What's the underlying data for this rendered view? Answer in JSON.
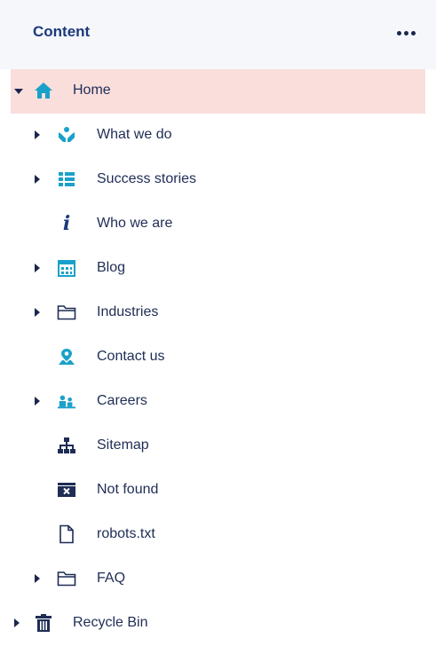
{
  "header": {
    "title": "Content",
    "more_icon": "ellipsis-icon"
  },
  "tree": {
    "root": {
      "label": "Home",
      "icon": "home-icon",
      "expanded": true,
      "selected": true
    },
    "children": [
      {
        "label": "What we do",
        "icon": "hands-icon",
        "has_children": true
      },
      {
        "label": "Success stories",
        "icon": "grid-list-icon",
        "has_children": true
      },
      {
        "label": "Who we are",
        "icon": "info-icon",
        "has_children": false
      },
      {
        "label": "Blog",
        "icon": "calendar-icon",
        "has_children": true
      },
      {
        "label": "Industries",
        "icon": "folder-icon",
        "has_children": true
      },
      {
        "label": "Contact us",
        "icon": "map-pin-icon",
        "has_children": false
      },
      {
        "label": "Careers",
        "icon": "users-icon",
        "has_children": true
      },
      {
        "label": "Sitemap",
        "icon": "sitemap-icon",
        "has_children": false
      },
      {
        "label": "Not found",
        "icon": "window-close-icon",
        "has_children": false
      },
      {
        "label": "robots.txt",
        "icon": "document-icon",
        "has_children": false
      },
      {
        "label": "FAQ",
        "icon": "folder-icon",
        "has_children": true
      }
    ],
    "recycle_bin": {
      "label": "Recycle Bin",
      "icon": "trash-icon",
      "has_children": true
    }
  },
  "colors": {
    "selected_bg": "#f9dedc",
    "accent": "#1aa1c9",
    "text": "#1f2d55",
    "header_bg": "#f6f7fb"
  }
}
